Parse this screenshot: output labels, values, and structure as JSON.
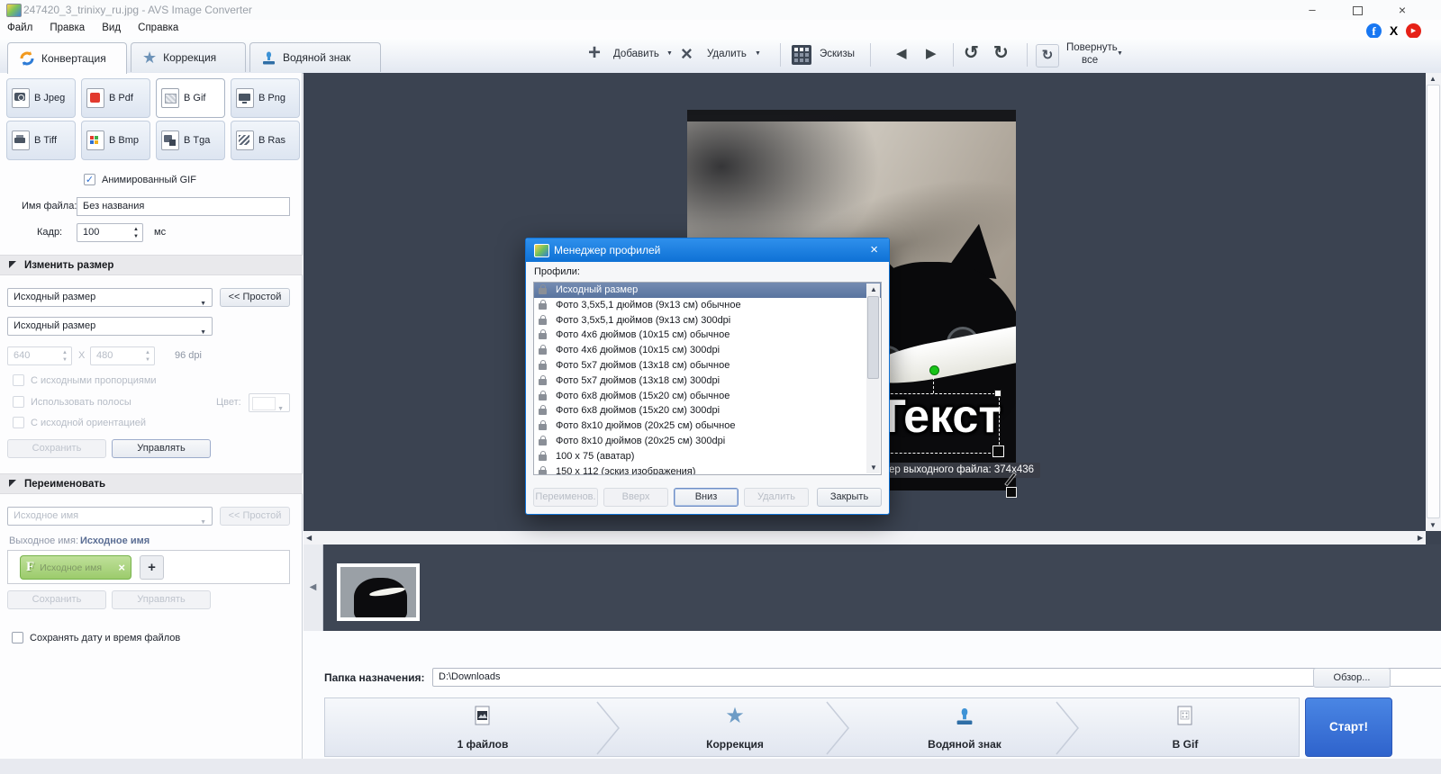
{
  "window": {
    "title": "247420_3_trinixy_ru.jpg - AVS Image Converter",
    "minimize": "–",
    "close": "×"
  },
  "menu": {
    "items": [
      "Файл",
      "Правка",
      "Вид",
      "Справка"
    ]
  },
  "social": {
    "facebook": "f",
    "x": "X"
  },
  "tabs": {
    "convert": "Конвертация",
    "correct": "Коррекция",
    "watermark": "Водяной знак"
  },
  "toolbar": {
    "add": "Добавить",
    "remove": "Удалить",
    "thumbs": "Эскизы",
    "rotate1": "Повернуть",
    "rotate2": "все"
  },
  "formats": {
    "jpeg": "В Jpeg",
    "pdf": "В Pdf",
    "gif": "В Gif",
    "png": "В Png",
    "tiff": "В Tiff",
    "bmp": "В Bmp",
    "tga": "В Tga",
    "ras": "В Ras"
  },
  "convert": {
    "animated": "Анимированный GIF",
    "filename_label": "Имя файла:",
    "filename": "Без названия",
    "frame_label": "Кадр:",
    "frame": "100",
    "unit": "мс"
  },
  "resize": {
    "header": "Изменить размер",
    "preset": "Исходный размер",
    "simple": "<< Простой",
    "preset2": "Исходный размер",
    "w": "640",
    "x": "X",
    "h": "480",
    "dpi": "96 dpi",
    "prop": "С исходными пропорциями",
    "bands": "Использовать полосы",
    "orient": "С исходной ориентацией",
    "color_label": "Цвет:",
    "save": "Сохранить",
    "manage": "Управлять"
  },
  "rename": {
    "header": "Переименовать",
    "preset": "Исходное имя",
    "simple": "<< Простой",
    "out_label": "Выходное имя:",
    "out_value": "Исходное имя",
    "tag_letter": "F",
    "tag_text": "Исходное имя",
    "tag_close": "×",
    "add": "+",
    "save": "Сохранить",
    "manage": "Управлять"
  },
  "keep_date": "Сохранять дату и время файлов",
  "dialog": {
    "title": "Менеджер профилей",
    "close": "×",
    "label": "Профили:",
    "profiles": [
      "Исходный размер",
      "Фото 3,5x5,1 дюймов (9x13 см) обычное",
      "Фото 3,5x5,1 дюймов (9x13 см) 300dpi",
      "Фото 4x6 дюймов (10x15 см) обычное",
      "Фото 4x6 дюймов (10x15 см) 300dpi",
      "Фото 5x7 дюймов (13x18 см) обычное",
      "Фото 5x7 дюймов (13x18 см) 300dpi",
      "Фото 6x8 дюймов (15x20 см) обычное",
      "Фото 6x8 дюймов (15x20 см) 300dpi",
      "Фото 8x10 дюймов (20x25 см) обычное",
      "Фото 8x10 дюймов (20x25 см) 300dpi",
      "100 x 75 (аватар)",
      "150 x 112 (эскиз изображения)"
    ],
    "btn_rename": "Переименов.",
    "btn_up": "Вверх",
    "btn_down": "Вниз",
    "btn_delete": "Удалить",
    "btn_close": "Закрыть"
  },
  "preview": {
    "watermark": "Текст",
    "tooltip": "ер выходного файла: 374x436"
  },
  "destination": {
    "label": "Папка назначения:",
    "value": "D:\\Downloads",
    "browse": "Обзор..."
  },
  "steps": {
    "files": "1 файлов",
    "correct": "Коррекция",
    "watermark": "Водяной знак",
    "format": "В Gif",
    "start": "Старт!"
  },
  "glyphs": {
    "dropdown": "▼",
    "up": "▲",
    "down": "▼",
    "check": "✓",
    "left": "◀",
    "right": "▶",
    "rot_ccw": "↺",
    "rot_cw": "↻",
    "plus": "+",
    "cross": "×",
    "star": "★",
    "play": "▶"
  },
  "colors": {
    "accent": "#2f63cc",
    "dialog_title": "#0e71d5",
    "selection": "#59749f",
    "tag_green": "#9ccb6c",
    "preview_bg": "#3b4351"
  }
}
